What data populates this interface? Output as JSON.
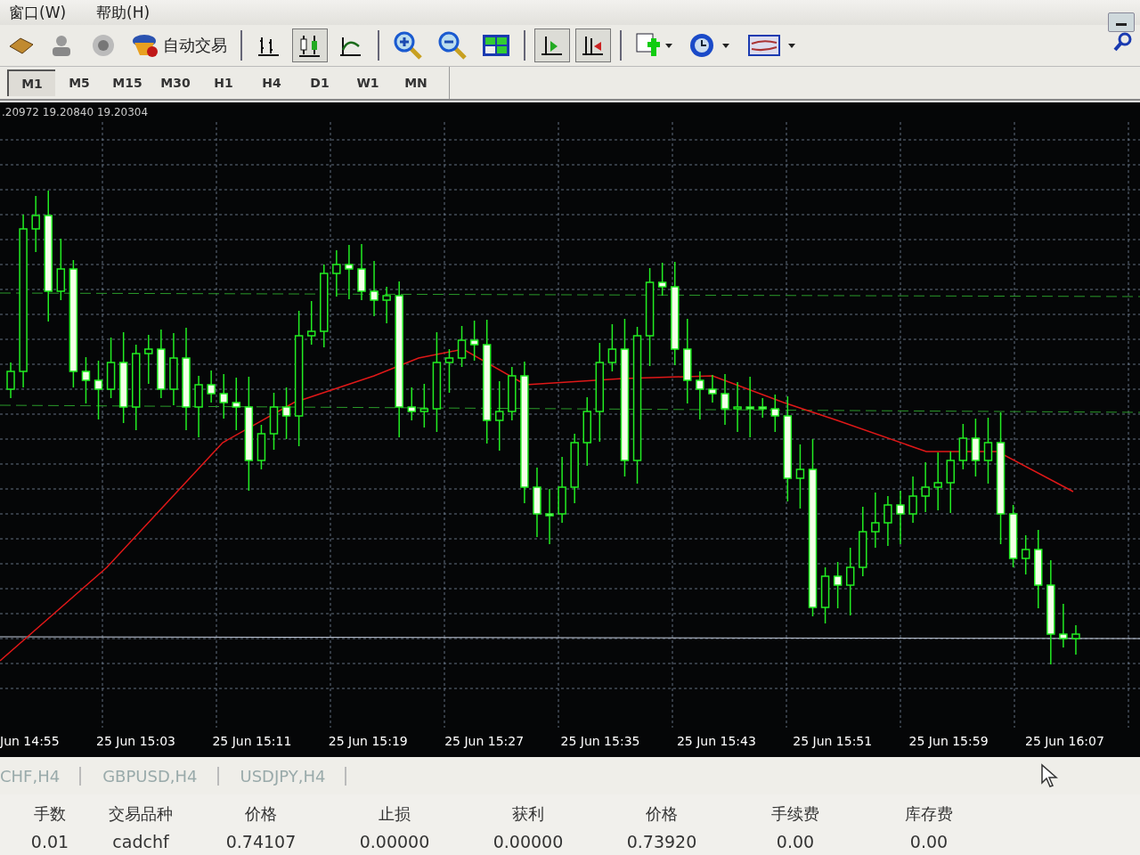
{
  "menu": [
    "窗口(W)",
    "帮助(H)"
  ],
  "toolbar": [
    {
      "kind": "book",
      "pressed": false
    },
    {
      "kind": "person",
      "pressed": false
    },
    {
      "kind": "signal",
      "pressed": false
    },
    {
      "kind": "autotrade",
      "label": "自动交易",
      "pressed": false
    },
    {
      "kind": "sep"
    },
    {
      "kind": "bars",
      "pressed": false
    },
    {
      "kind": "candles",
      "pressed": true
    },
    {
      "kind": "line",
      "pressed": false
    },
    {
      "kind": "sep"
    },
    {
      "kind": "zoomin",
      "pressed": false
    },
    {
      "kind": "zoomout",
      "pressed": false
    },
    {
      "kind": "tile",
      "pressed": false
    },
    {
      "kind": "sep"
    },
    {
      "kind": "scroll",
      "pressed": true
    },
    {
      "kind": "shift",
      "pressed": true
    },
    {
      "kind": "sep"
    },
    {
      "kind": "newchart",
      "pressed": false
    },
    {
      "kind": "clock",
      "pressed": false
    },
    {
      "kind": "template",
      "pressed": false
    }
  ],
  "timeframes": [
    {
      "label": "M1",
      "selected": true
    },
    {
      "label": "M5",
      "selected": false
    },
    {
      "label": "M15",
      "selected": false
    },
    {
      "label": "M30",
      "selected": false
    },
    {
      "label": "H1",
      "selected": false
    },
    {
      "label": "H4",
      "selected": false
    },
    {
      "label": "D1",
      "selected": false
    },
    {
      "label": "W1",
      "selected": false
    },
    {
      "label": "MN",
      "selected": false
    }
  ],
  "chart": {
    "info": ".20972 19.20840 19.20304",
    "time_labels": [
      "Jun 14:55",
      "25 Jun 15:03",
      "25 Jun 15:11",
      "25 Jun 15:19",
      "25 Jun 15:27",
      "25 Jun 15:35",
      "25 Jun 15:43",
      "25 Jun 15:51",
      "25 Jun 15:59",
      "25 Jun 16:07"
    ]
  },
  "chart_tabs": [
    "CHF,H4",
    "GBPUSD,H4",
    "USDJPY,H4"
  ],
  "table": {
    "columns": [
      "手数",
      "交易品种",
      "价格",
      "止损",
      "获利",
      "价格",
      "手续费",
      "库存费"
    ],
    "rows": [
      [
        "0.01",
        "cadchf",
        "0.74107",
        "0.00000",
        "0.00000",
        "0.73920",
        "0.00",
        "0.00"
      ]
    ]
  }
}
